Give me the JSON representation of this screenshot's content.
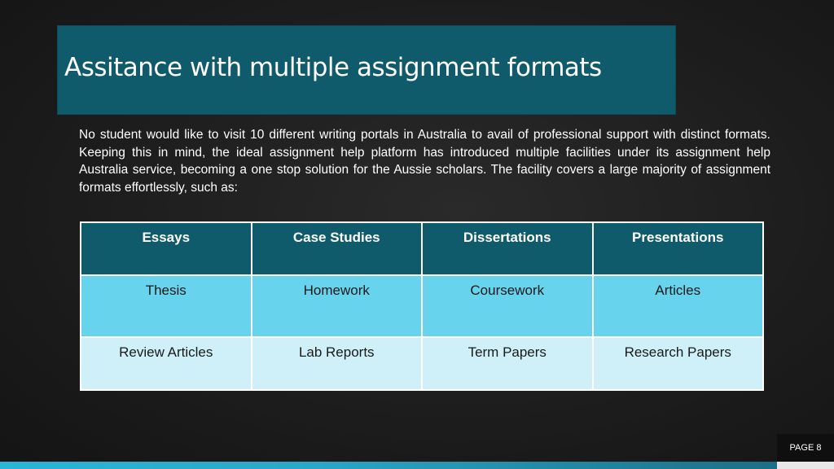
{
  "slide": {
    "title": "Assitance with multiple assignment formats",
    "body": "No student would like to visit 10 different writing portals in Australia to avail of professional support with distinct formats. Keeping this in mind, the ideal assignment help platform has introduced multiple facilities under its assignment help Australia service, becoming a one stop solution for the Aussie scholars. The facility covers a large majority of assignment formats effortlessly, such as:",
    "page_label": "PAGE 8"
  },
  "table": {
    "rows": [
      [
        "Essays",
        "Case Studies",
        "Dissertations",
        "Presentations"
      ],
      [
        "Thesis",
        "Homework",
        "Coursework",
        "Articles"
      ],
      [
        "Review Articles",
        "Lab Reports",
        "Term Papers",
        "Research Papers"
      ]
    ]
  },
  "colors": {
    "title_bg": "#0f5a6b",
    "header_row_bg": "#0f5a6b",
    "row_1_bg": "#67d3ed",
    "row_2_bg": "#cff0f9",
    "accent_bar": "#29b6d9"
  }
}
